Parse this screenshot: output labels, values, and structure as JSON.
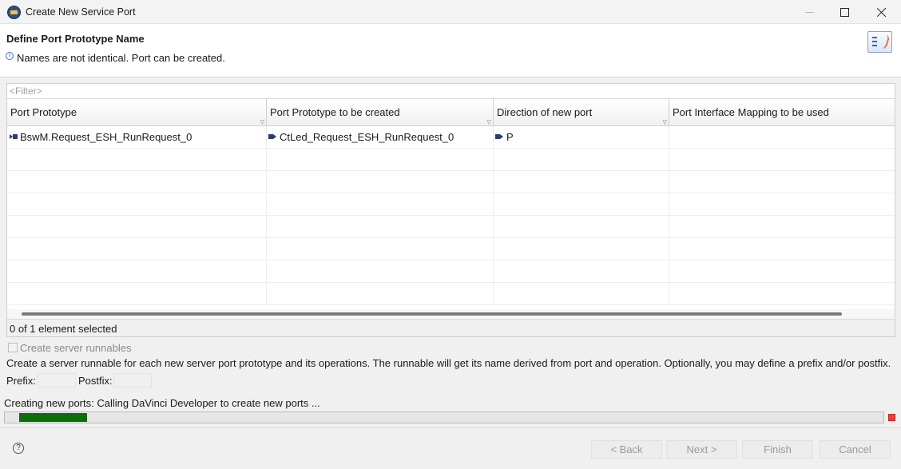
{
  "window": {
    "title": "Create New Service Port",
    "icon": "app-icon",
    "controls": [
      "minimize-icon",
      "maximize-icon",
      "close-icon"
    ]
  },
  "header": {
    "page_title": "Define Port Prototype Name",
    "info_icon": "i",
    "message": "Names are not identical. Port can be created."
  },
  "filter": {
    "placeholder": "<Filter>"
  },
  "table": {
    "columns": [
      {
        "label": "Port Prototype"
      },
      {
        "label": "Port Prototype to be created"
      },
      {
        "label": "Direction of new port"
      },
      {
        "label": "Port Interface Mapping to be used"
      }
    ],
    "rows": [
      {
        "port_prototype": "BswM.Request_ESH_RunRequest_0",
        "port_prototype_icon": "require-port-icon",
        "to_be_created": "CtLed_Request_ESH_RunRequest_0",
        "to_be_created_icon": "provide-port-icon",
        "direction": "P",
        "direction_icon": "provide-port-icon",
        "interface_mapping": ""
      }
    ],
    "selection_status": "0 of 1 element selected"
  },
  "runnables": {
    "checkbox_label": "Create server runnables",
    "checked": false,
    "description": "Create a server runnable for each new server port prototype and its operations. The runnable will get its name derived from port and operation. Optionally, you may define a prefix and/or postfix.",
    "prefix_label": "Prefix:",
    "prefix_value": "",
    "postfix_label": "Postfix:",
    "postfix_value": ""
  },
  "progress": {
    "label": "Creating new ports: Calling DaVinci Developer to create new ports ...",
    "fill_fraction": 0.077,
    "fill_color": "#0b6e0b"
  },
  "footer": {
    "help_icon": "?",
    "back_label": "< Back",
    "next_label": "Next >",
    "finish_label": "Finish",
    "cancel_label": "Cancel"
  }
}
